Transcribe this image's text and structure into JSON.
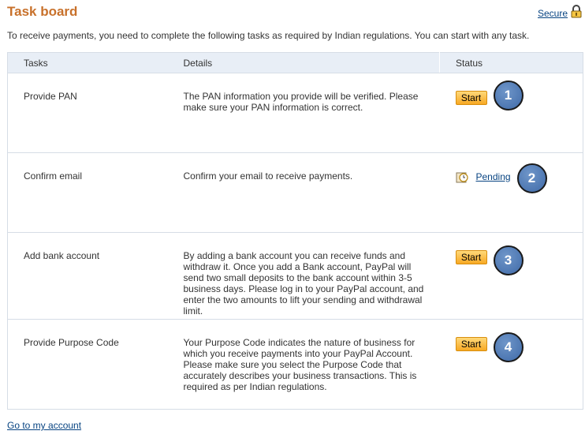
{
  "header": {
    "title": "Task board",
    "secure_label": "Secure"
  },
  "intro": "To receive payments, you need to complete the following tasks as required by Indian regulations. You can start with any task.",
  "table": {
    "columns": [
      "Tasks",
      "Details",
      "Status"
    ],
    "rows": [
      {
        "task": "Provide PAN",
        "details": "The PAN information you provide will be verified. Please make sure your PAN information is correct.",
        "status": "Start",
        "badge": "1"
      },
      {
        "task": "Confirm email",
        "details": "Confirm your email to receive payments.",
        "status": "Pending",
        "badge": "2"
      },
      {
        "task": "Add bank account",
        "details": "By adding a bank account you can receive funds and withdraw it. Once you add a Bank account, PayPal will send two small deposits to the bank account within 3-5 business days. Please log in to your PayPal account, and enter the two amounts to lift your sending and withdrawal limit.",
        "status": "Start",
        "badge": "3"
      },
      {
        "task": "Provide Purpose Code",
        "details": "Your Purpose Code indicates the nature of business for which you receive payments into your PayPal Account. Please make sure you select the Purpose Code that accurately describes your business transactions. This is required as per Indian regulations.",
        "status": "Start",
        "badge": "4"
      }
    ]
  },
  "footer": {
    "link_label": "Go to my account"
  },
  "colors": {
    "title": "#c8712b",
    "link": "#084482",
    "header_bg": "#e8eef6",
    "button": "#f7a824",
    "badge": "#4f7bb8"
  },
  "icons": {
    "secure": "lock-icon",
    "pending": "clock-icon"
  }
}
